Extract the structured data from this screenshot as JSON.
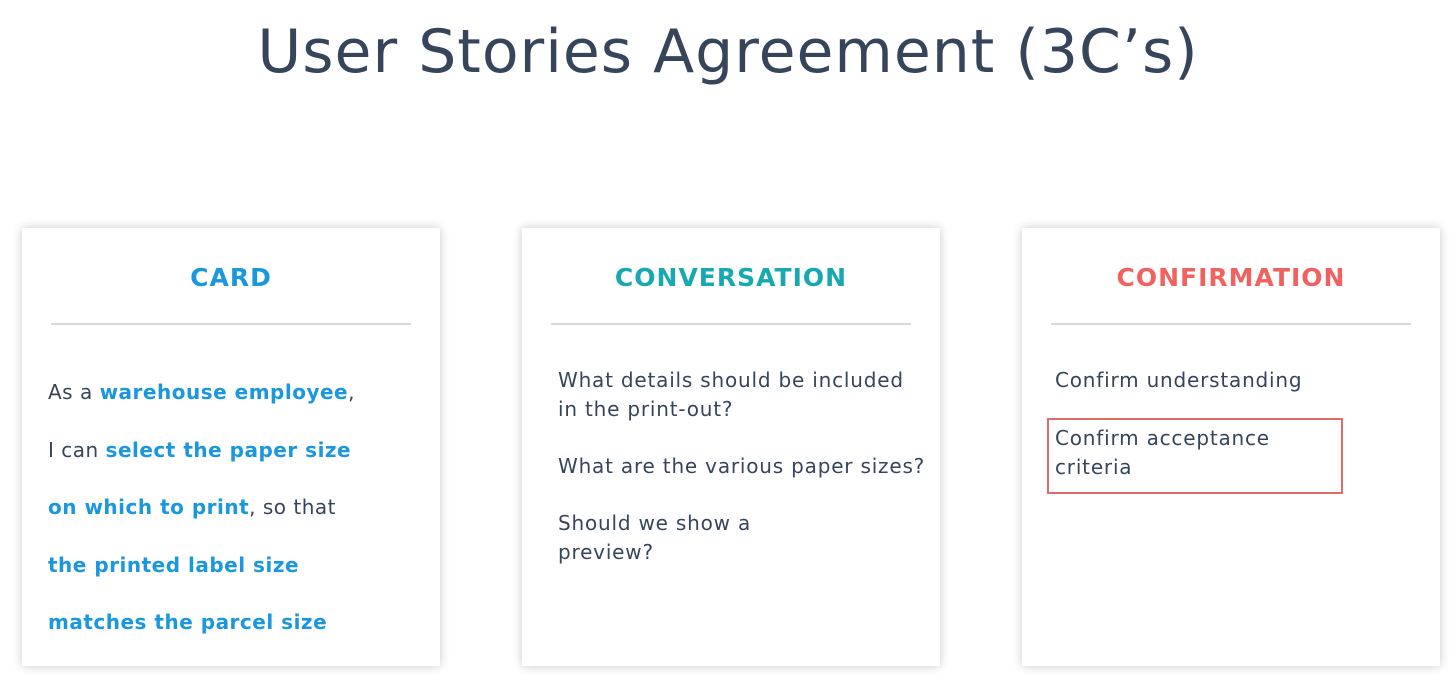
{
  "title": "User Stories Agreement (3C’s)",
  "colors": {
    "card_header": "#1a97dd",
    "conversation_header": "#17a8b0",
    "confirmation_header": "#f0625f",
    "highlight_text": "#1a97dd",
    "body_text": "#37455a",
    "highlight_box_border": "#e26a67"
  },
  "cards": {
    "card": {
      "header": "CARD",
      "story": {
        "p1": "As a ",
        "role": "warehouse employee",
        "p2": ",",
        "p3": "I can ",
        "goal_a": "select the paper size",
        "goal_b": "on which to print",
        "p4": ", so that",
        "benefit_a": "the printed label size",
        "benefit_b": "matches the parcel size"
      }
    },
    "conversation": {
      "header": "CONVERSATION",
      "questions": [
        "What details should be included in the print-out?",
        "What are the various paper sizes?",
        "Should we show a preview?"
      ]
    },
    "confirmation": {
      "header": "CONFIRMATION",
      "items": [
        "Confirm understanding",
        "Confirm acceptance criteria"
      ]
    }
  }
}
